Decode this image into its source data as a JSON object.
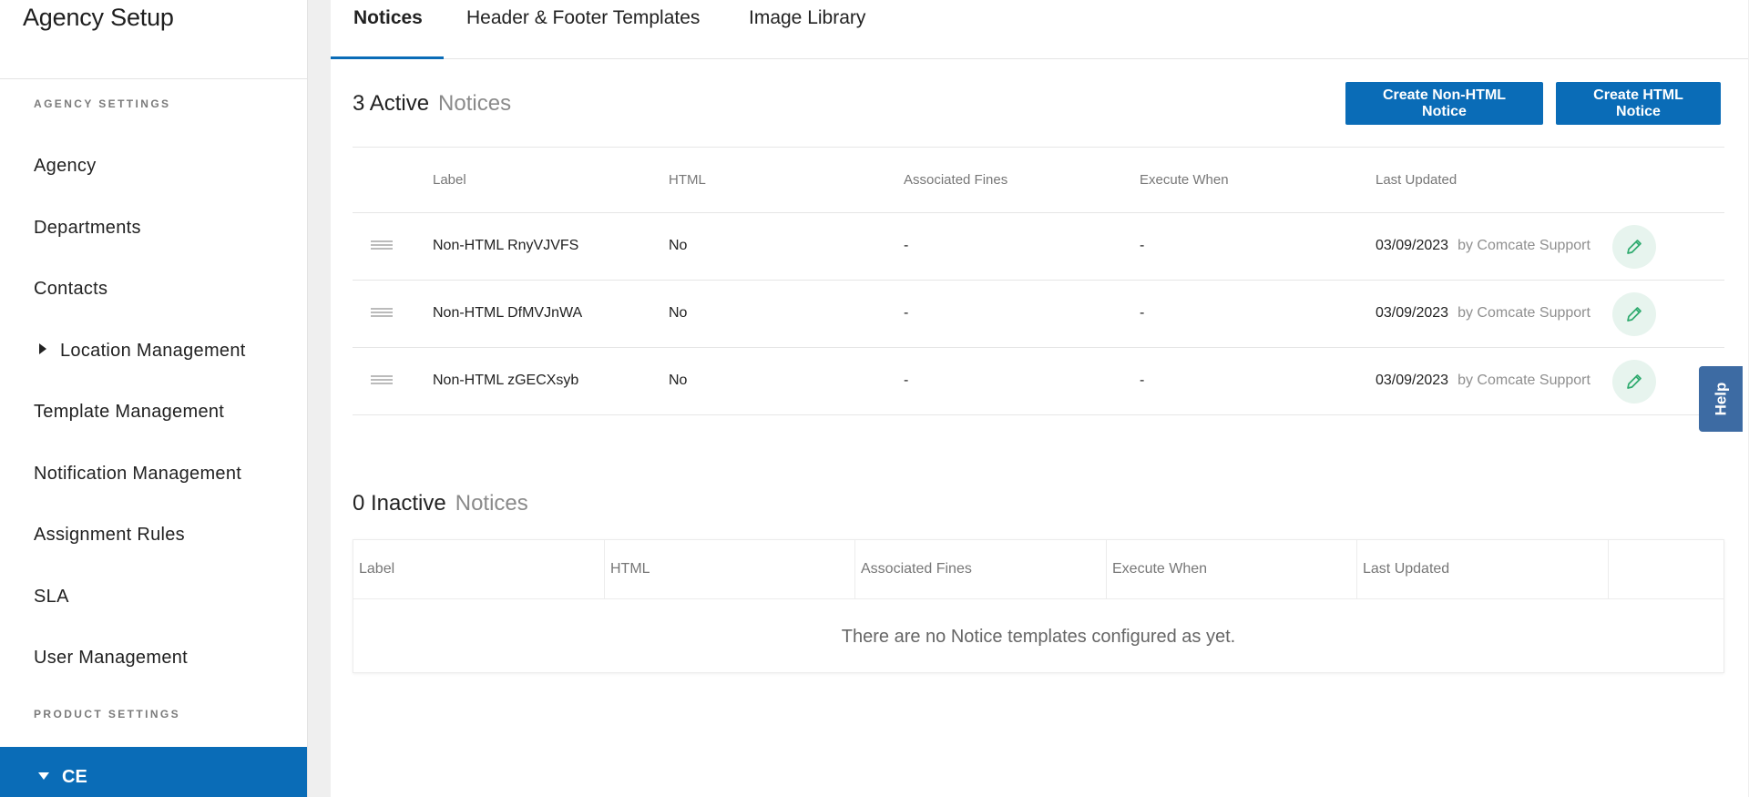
{
  "sidebar": {
    "title": "Agency Setup",
    "agency_settings_label": "AGENCY SETTINGS",
    "product_settings_label": "PRODUCT SETTINGS",
    "items": [
      {
        "label": "Agency"
      },
      {
        "label": "Departments"
      },
      {
        "label": "Contacts"
      },
      {
        "label": "Location Management"
      },
      {
        "label": "Template Management"
      },
      {
        "label": "Notification Management"
      },
      {
        "label": "Assignment Rules"
      },
      {
        "label": "SLA"
      },
      {
        "label": "User Management"
      }
    ],
    "active_product": "CE"
  },
  "tabs": [
    {
      "label": "Notices",
      "active": true
    },
    {
      "label": "Header & Footer Templates",
      "active": false
    },
    {
      "label": "Image Library",
      "active": false
    }
  ],
  "active_section": {
    "count_label": "3 Active",
    "sub_label": "Notices",
    "buttons": {
      "create_non_html": "Create Non-HTML Notice",
      "create_html": "Create HTML Notice"
    },
    "columns": [
      "Label",
      "HTML",
      "Associated Fines",
      "Execute When",
      "Last Updated"
    ],
    "rows": [
      {
        "label": "Non-HTML RnyVJVFS",
        "html": "No",
        "fines": "-",
        "execute": "-",
        "date": "03/09/2023",
        "by": "by Comcate Support"
      },
      {
        "label": "Non-HTML DfMVJnWA",
        "html": "No",
        "fines": "-",
        "execute": "-",
        "date": "03/09/2023",
        "by": "by Comcate Support"
      },
      {
        "label": "Non-HTML zGECXsyb",
        "html": "No",
        "fines": "-",
        "execute": "-",
        "date": "03/09/2023",
        "by": "by Comcate Support"
      }
    ]
  },
  "inactive_section": {
    "count_label": "0 Inactive",
    "sub_label": "Notices",
    "columns": [
      "Label",
      "HTML",
      "Associated Fines",
      "Execute When",
      "Last Updated"
    ],
    "empty_message": "There are no Notice templates configured as yet."
  },
  "help": {
    "label": "Help"
  },
  "colors": {
    "primary": "#0a6cb7",
    "edit_bg": "#e7f4ee",
    "edit_icon": "#2eaa6e",
    "help_bg": "#3d6ba3"
  },
  "icons": {
    "drag": "drag-handle-icon",
    "edit": "pencil-icon",
    "expand": "caret-right-icon",
    "collapse": "caret-down-icon"
  }
}
